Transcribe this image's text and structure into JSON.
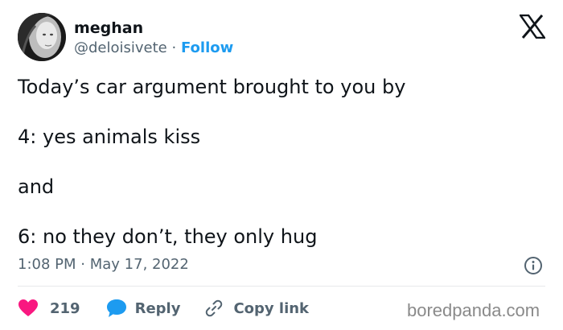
{
  "author": {
    "display_name": "meghan",
    "handle": "@deloisivete",
    "separator": "·",
    "follow_label": "Follow"
  },
  "tweet": {
    "lines": [
      "Today’s car argument brought to you by",
      "4: yes animals kiss",
      "and",
      "6: no they don’t, they only hug"
    ],
    "time": "1:08 PM",
    "time_separator": "·",
    "date": "May 17, 2022"
  },
  "actions": {
    "likes": "219",
    "reply_label": "Reply",
    "copy_link_label": "Copy link"
  },
  "watermark": "boredpanda.com",
  "icons": {
    "platform": "x-logo-icon",
    "info": "info-icon",
    "like": "heart-icon",
    "reply": "speech-bubble-icon",
    "copy": "link-icon"
  },
  "colors": {
    "accent": "#1d9bf0",
    "like": "#f91880",
    "text": "#0f1419",
    "secondary": "#536471",
    "divider": "#e7e9ea"
  }
}
